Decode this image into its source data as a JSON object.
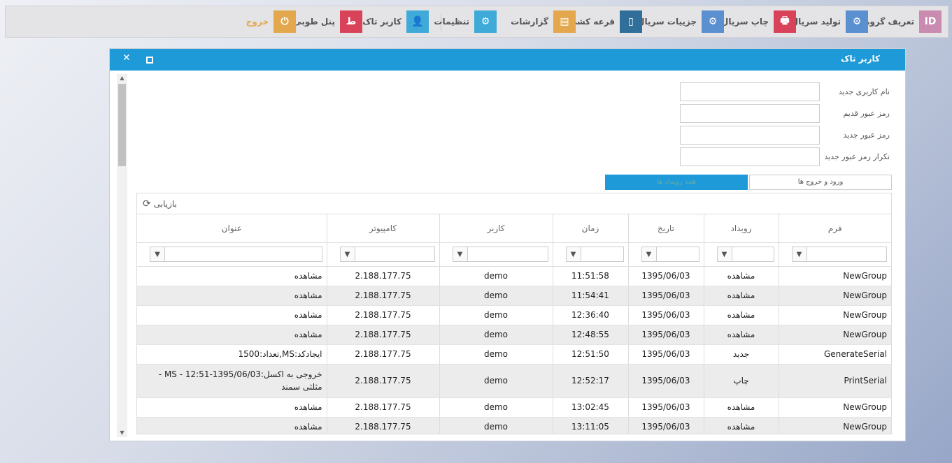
{
  "toolbar": {
    "items": [
      {
        "label": "تعریف گروه",
        "icon": "id-icon",
        "glyph": "ID",
        "color": "#c98bb0"
      },
      {
        "label": "تولید سریال",
        "icon": "gears-icon",
        "glyph": "⚙",
        "color": "#5a8fd0"
      },
      {
        "label": "چاپ سریال",
        "icon": "printer-icon",
        "glyph": "🖶",
        "color": "#d9435a"
      },
      {
        "label": "جزییات سریال",
        "icon": "gears-icon",
        "glyph": "⚙",
        "color": "#5a8fd0"
      },
      {
        "label": "قرعه کشی",
        "icon": "mobile-icon",
        "glyph": "▯",
        "color": "#2f6f9a"
      },
      {
        "label": "گزارشات",
        "icon": "document-icon",
        "glyph": "▤",
        "color": "#e3a84d"
      },
      {
        "label": "تنظیمات",
        "icon": "gear-icon",
        "glyph": "⚙",
        "color": "#3fa9d8"
      },
      {
        "label": "کاربر تاک",
        "icon": "user-icon",
        "glyph": "👤",
        "color": "#3fa9d8"
      },
      {
        "label": "پنل طوبی",
        "icon": "toba-logo-icon",
        "glyph": "ط",
        "color": "#d9435a"
      },
      {
        "label": "خروج",
        "icon": "power-icon",
        "glyph": "⏻",
        "color": "#e3a84d"
      }
    ]
  },
  "window": {
    "title": "کاربر تاک",
    "close_glyph": "✕"
  },
  "form": {
    "fields": [
      {
        "label": "نام کاربری جدید",
        "value": ""
      },
      {
        "label": "رمز عبور قدیم",
        "value": ""
      },
      {
        "label": "رمز عبور جدید",
        "value": ""
      },
      {
        "label": "تکرار رمز عبور جدید",
        "value": ""
      }
    ]
  },
  "tabs": {
    "login_logout": "ورود و خروج ها",
    "all_events": "همه رویداد ها"
  },
  "grid": {
    "refresh_label": "بازیابی",
    "columns": [
      "عنوان",
      "کامپیوتر",
      "کاربر",
      "زمان",
      "تاریخ",
      "رویداد",
      "فرم"
    ],
    "rows": [
      [
        "مشاهده",
        "2.188.177.75",
        "demo",
        "11:51:58",
        "1395/06/03",
        "مشاهده",
        "NewGroup"
      ],
      [
        "مشاهده",
        "2.188.177.75",
        "demo",
        "11:54:41",
        "1395/06/03",
        "مشاهده",
        "NewGroup"
      ],
      [
        "مشاهده",
        "2.188.177.75",
        "demo",
        "12:36:40",
        "1395/06/03",
        "مشاهده",
        "NewGroup"
      ],
      [
        "مشاهده",
        "2.188.177.75",
        "demo",
        "12:48:55",
        "1395/06/03",
        "مشاهده",
        "NewGroup"
      ],
      [
        "ایجادکد:MS,تعداد:1500",
        "2.188.177.75",
        "demo",
        "12:51:50",
        "1395/06/03",
        "جدید",
        "GenerateSerial"
      ],
      [
        "خروجی به اکسل:MS - 12:51-1395/06/03 - مثلثی سمند",
        "2.188.177.75",
        "demo",
        "12:52:17",
        "1395/06/03",
        "چاپ",
        "PrintSerial"
      ],
      [
        "مشاهده",
        "2.188.177.75",
        "demo",
        "13:02:45",
        "1395/06/03",
        "مشاهده",
        "NewGroup"
      ],
      [
        "مشاهده",
        "2.188.177.75",
        "demo",
        "13:11:05",
        "1395/06/03",
        "مشاهده",
        "NewGroup"
      ]
    ]
  }
}
